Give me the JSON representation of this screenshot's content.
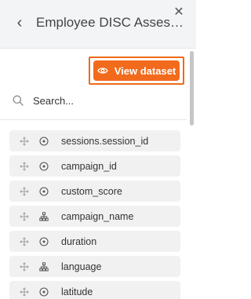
{
  "header": {
    "title": "Employee DISC Assessment Results",
    "back_icon": "chevron-left-icon",
    "close_icon": "close-icon"
  },
  "toolbar": {
    "view_dataset_label": "View dataset",
    "view_dataset_icon": "eye-icon",
    "accent_color": "#f26b1d"
  },
  "search": {
    "placeholder": "Search...",
    "value": ""
  },
  "fields": [
    {
      "label": "sessions.session_id",
      "type_icon": "measure-icon"
    },
    {
      "label": "campaign_id",
      "type_icon": "measure-icon"
    },
    {
      "label": "custom_score",
      "type_icon": "measure-icon"
    },
    {
      "label": "campaign_name",
      "type_icon": "hierarchy-icon"
    },
    {
      "label": "duration",
      "type_icon": "measure-icon"
    },
    {
      "label": "language",
      "type_icon": "hierarchy-icon"
    },
    {
      "label": "latitude",
      "type_icon": "measure-icon"
    }
  ]
}
